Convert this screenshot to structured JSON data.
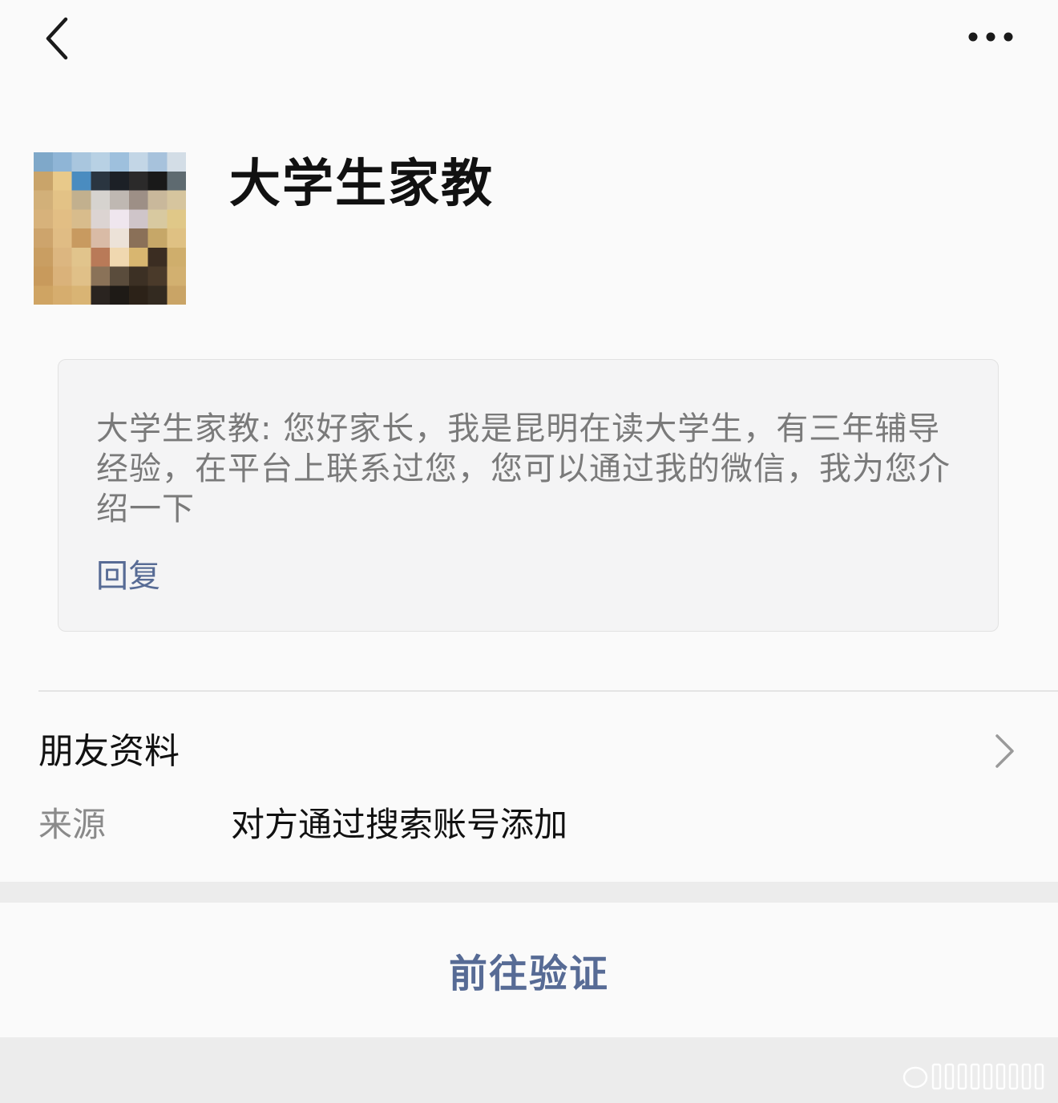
{
  "header": {
    "back_icon": "chevron-left-icon",
    "more_icon": "more-horizontal-icon"
  },
  "profile": {
    "name": "大学生家教",
    "avatar_icon": "avatar-mosaic"
  },
  "message": {
    "text": "大学生家教: 您好家长，我是昆明在读大学生，有三年辅导经验，在平台上联系过您，您可以通过我的微信，我为您介绍一下",
    "reply_label": "回复"
  },
  "friend_info": {
    "label": "朋友资料",
    "chevron_icon": "chevron-right-icon",
    "source_label": "来源",
    "source_value": "对方通过搜索账号添加"
  },
  "action": {
    "verify_label": "前往验证"
  },
  "colors": {
    "link": "#576b95",
    "background": "#fafafa",
    "separator": "#ececec",
    "card": "#f4f4f5"
  }
}
